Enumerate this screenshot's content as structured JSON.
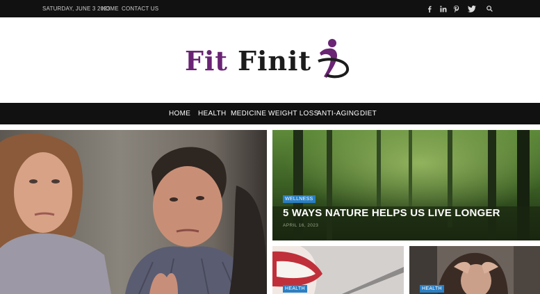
{
  "topbar": {
    "date": "SATURDAY, JUNE 3 2023",
    "links": [
      "HOME",
      "CONTACT US"
    ],
    "social_icons": [
      "facebook-icon",
      "linkedin-icon",
      "pinterest-icon",
      "twitter-icon"
    ],
    "search_icon": "search-icon"
  },
  "logo": {
    "word1": "Fit",
    "word2": "Finit",
    "colors": {
      "purple": "#6a2474",
      "dark": "#1c1c1c"
    }
  },
  "nav": {
    "items": [
      "HOME",
      "HEALTH",
      "MEDICINE",
      "WEIGHT LOSS",
      "ANTI-AGING",
      "DIET"
    ]
  },
  "posts": {
    "featured_side": {
      "category": "WELLNESS",
      "title": "5 WAYS NATURE HELPS US LIVE LONGER",
      "date": "APRIL 16, 2023"
    },
    "small1": {
      "category": "HEALTH"
    },
    "small2": {
      "category": "HEALTH"
    }
  },
  "colors": {
    "topbar_bg": "#111111",
    "badge_bg": "#2a7fc4"
  }
}
